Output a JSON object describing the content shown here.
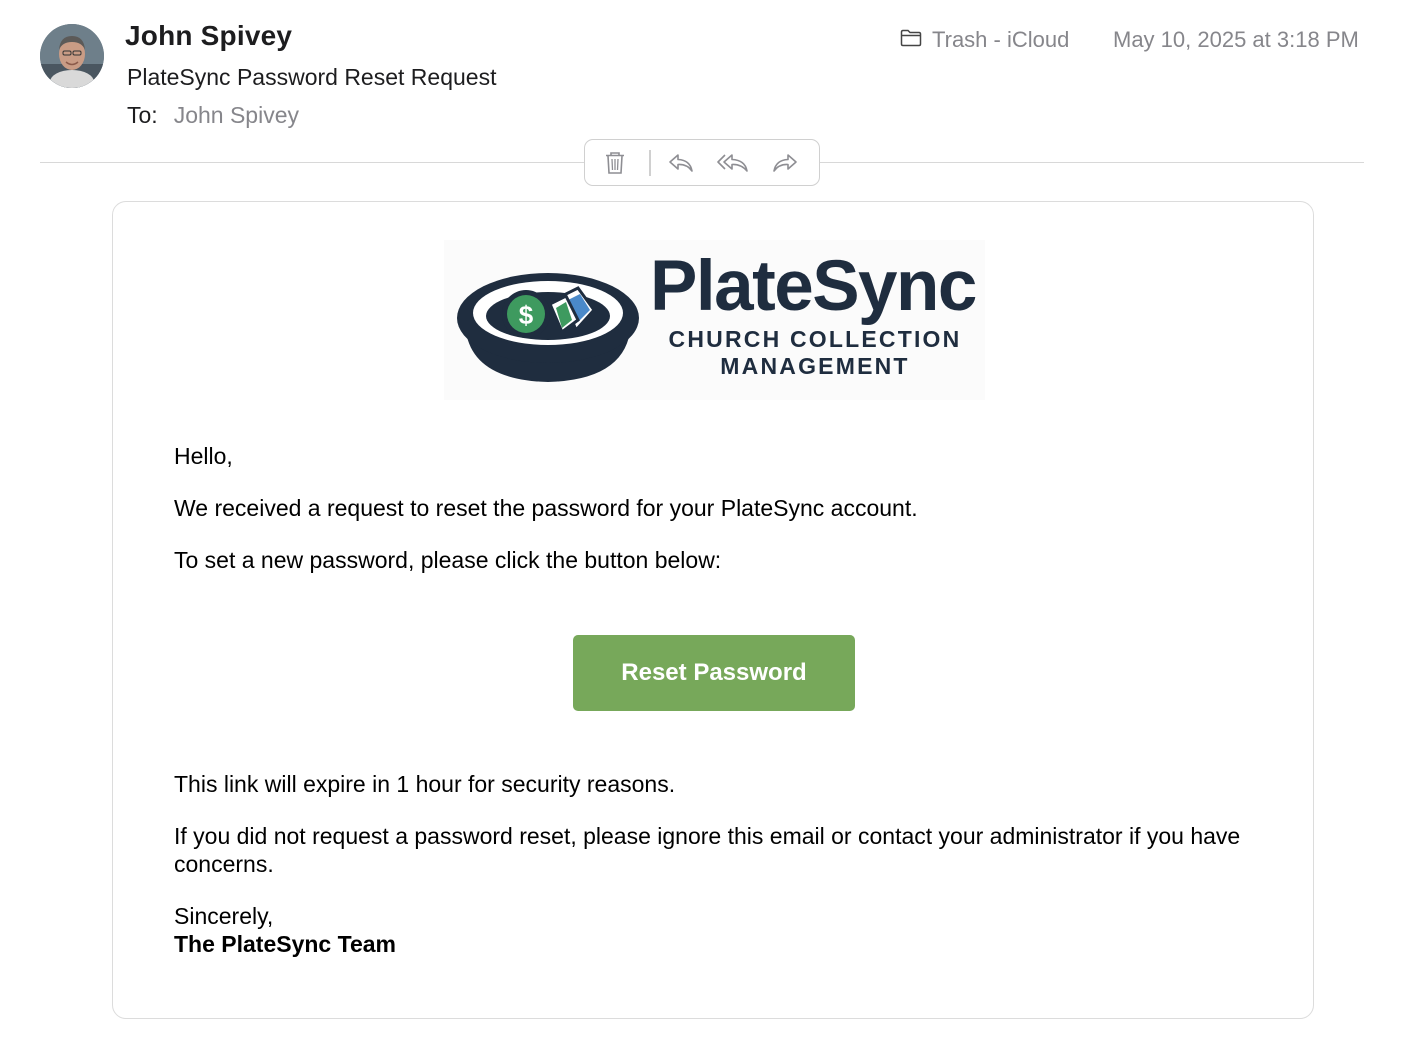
{
  "header": {
    "sender": "John Spivey",
    "subject": "PlateSync Password Reset Request",
    "to_label": "To:",
    "to_value": "John Spivey",
    "mailbox": "Trash - iCloud",
    "mailbox_icon": "folder-icon",
    "date": "May 10, 2025 at 3:18 PM"
  },
  "toolbar": {
    "buttons": [
      "trash-icon",
      "reply-icon",
      "reply-all-icon",
      "forward-icon"
    ]
  },
  "email": {
    "logo": {
      "wordmark": "PlateSync",
      "tagline": "CHURCH COLLECTION MANAGEMENT",
      "colors": {
        "navy": "#1f2d3f",
        "green": "#3e9a5f",
        "blue": "#4a89c9"
      }
    },
    "greeting": "Hello,",
    "intro": "We received a request to reset the password for your PlateSync account.",
    "instruction": "To set a new password, please click the button below:",
    "button_label": "Reset Password",
    "button_color": "#77a85a",
    "expiry_note": "This link will expire in 1 hour for security reasons.",
    "ignore_note": "If you did not request a password reset, please ignore this email or contact your administrator if you have concerns.",
    "closing": "Sincerely,",
    "signature": "The PlateSync Team"
  }
}
